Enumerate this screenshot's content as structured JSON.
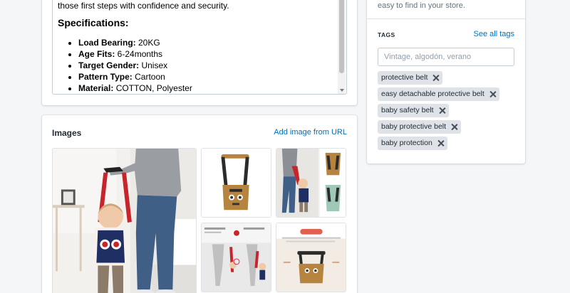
{
  "description": {
    "intro_text": "those first steps with confidence and security.",
    "spec_heading": "Specifications:",
    "specs": [
      {
        "label": "Load Bearing:",
        "value": " 20KG"
      },
      {
        "label": "Age Fits:",
        "value": " 6-24months"
      },
      {
        "label": "Target Gender:",
        "value": " Unisex"
      },
      {
        "label": "Pattern Type:",
        "value": " Cartoon"
      },
      {
        "label": "Material:",
        "value": " COTTON, Polyester"
      }
    ]
  },
  "images": {
    "title": "Images",
    "add_link": "Add image from URL"
  },
  "organization": {
    "description_text": "easy to find in your store.",
    "tags_title": "TAGS",
    "see_all_label": "See all tags",
    "tags_input_placeholder": "Vintage, algodón, verano",
    "tags": [
      "protective belt",
      "easy detachable protective belt",
      "baby safety belt",
      "baby protective belt",
      "baby protection"
    ]
  },
  "colors": {
    "link": "#006fbb",
    "tag_bg": "#dfe3e8",
    "harness_red": "#c8242b",
    "harness_tan": "#b7843f"
  }
}
